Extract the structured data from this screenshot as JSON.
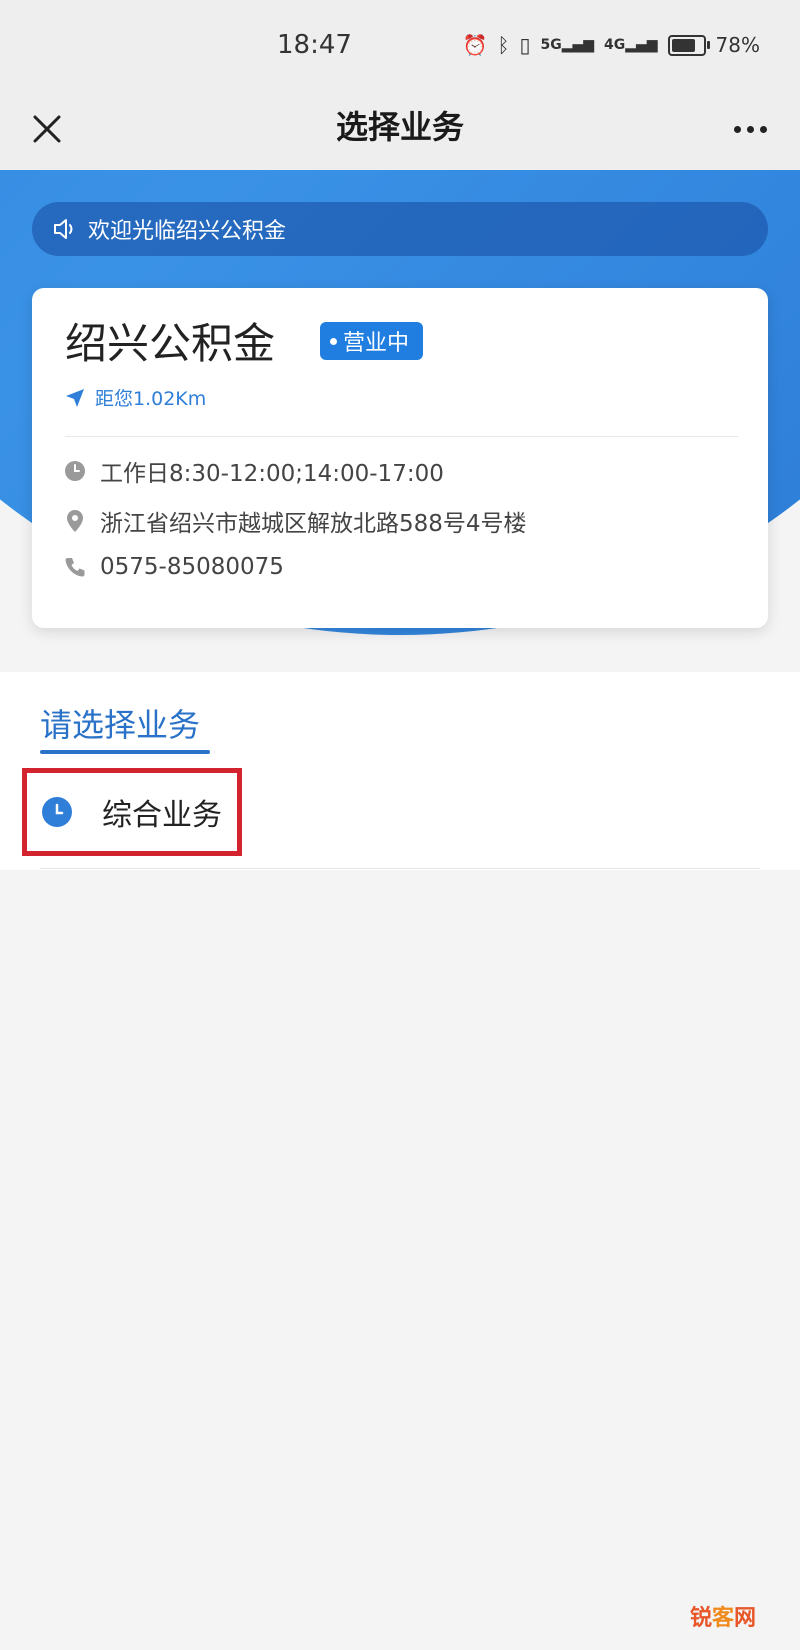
{
  "status_bar": {
    "time": "18:47",
    "signal_1": "5G",
    "signal_2": "4G",
    "battery_percent": "78%",
    "battery_level": 0.78
  },
  "nav": {
    "title": "选择业务",
    "close_icon": "close-icon",
    "more_icon": "more-icon"
  },
  "notice": {
    "text": "欢迎光临绍兴公积金"
  },
  "center": {
    "name": "绍兴公积金",
    "status_badge": "营业中",
    "distance": "距您1.02Km",
    "hours": "工作日8:30-12:00;14:00-17:00",
    "address": "浙江省绍兴市越城区解放北路588号4号楼",
    "phone": "0575-85080075"
  },
  "section": {
    "title": "请选择业务",
    "items": [
      {
        "label": "综合业务",
        "icon": "clock-icon"
      }
    ]
  },
  "watermark": {
    "part1": "锐",
    "part2": "客",
    "part3": "网"
  },
  "colors": {
    "primary": "#2f7fd8",
    "badge": "#1f7ee0",
    "highlight_border": "#d3232f"
  }
}
